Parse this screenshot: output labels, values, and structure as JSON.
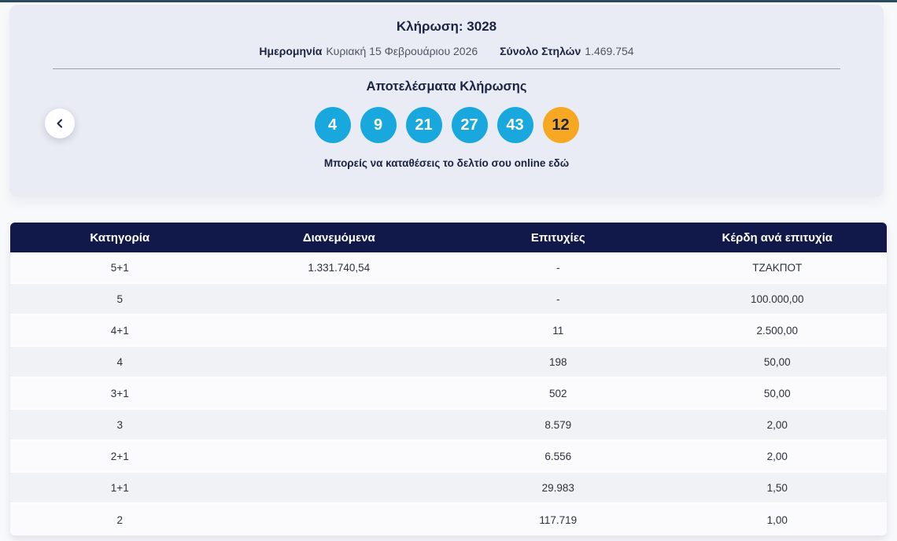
{
  "page": {
    "top_accent_color": "#2b4c5f",
    "background_color": "#f8f9fb"
  },
  "draw_card": {
    "title": "Κλήρωση: 3028",
    "date_label": "Ημερομηνία",
    "date_value": "Κυριακή 15 Φεβρουάριου 2026",
    "columns_label": "Σύνολο Στηλών",
    "columns_value": "1.469.754",
    "results_title": "Αποτελέσματα Κλήρωσης",
    "numbers": [
      {
        "value": "4",
        "type": "main"
      },
      {
        "value": "9",
        "type": "main"
      },
      {
        "value": "21",
        "type": "main"
      },
      {
        "value": "27",
        "type": "main"
      },
      {
        "value": "43",
        "type": "main"
      },
      {
        "value": "12",
        "type": "joker"
      }
    ],
    "online_link_text": "Μπορείς να καταθέσεις το δελτίο σου online εδώ",
    "colors": {
      "card_background": "#e9ecf4",
      "ball_main": "#18a8de",
      "ball_joker": "#f7a823"
    }
  },
  "nav": {
    "prev_button_icon": "chevron-left-icon"
  },
  "winnings_table": {
    "header_background": "#10194a",
    "headers": [
      "Κατηγορία",
      "Διανεμόμενα",
      "Επιτυχίες",
      "Κέρδη ανά επιτυχία"
    ],
    "rows": [
      {
        "category": "5+1",
        "distributed": "1.331.740,54",
        "winners": "-",
        "prize": "ΤΖΑΚΠΟΤ"
      },
      {
        "category": "5",
        "distributed": "",
        "winners": "-",
        "prize": "100.000,00"
      },
      {
        "category": "4+1",
        "distributed": "",
        "winners": "11",
        "prize": "2.500,00"
      },
      {
        "category": "4",
        "distributed": "",
        "winners": "198",
        "prize": "50,00"
      },
      {
        "category": "3+1",
        "distributed": "",
        "winners": "502",
        "prize": "50,00"
      },
      {
        "category": "3",
        "distributed": "",
        "winners": "8.579",
        "prize": "2,00"
      },
      {
        "category": "2+1",
        "distributed": "",
        "winners": "6.556",
        "prize": "2,00"
      },
      {
        "category": "1+1",
        "distributed": "",
        "winners": "29.983",
        "prize": "1,50"
      },
      {
        "category": "2",
        "distributed": "",
        "winners": "117.719",
        "prize": "1,00"
      }
    ]
  }
}
